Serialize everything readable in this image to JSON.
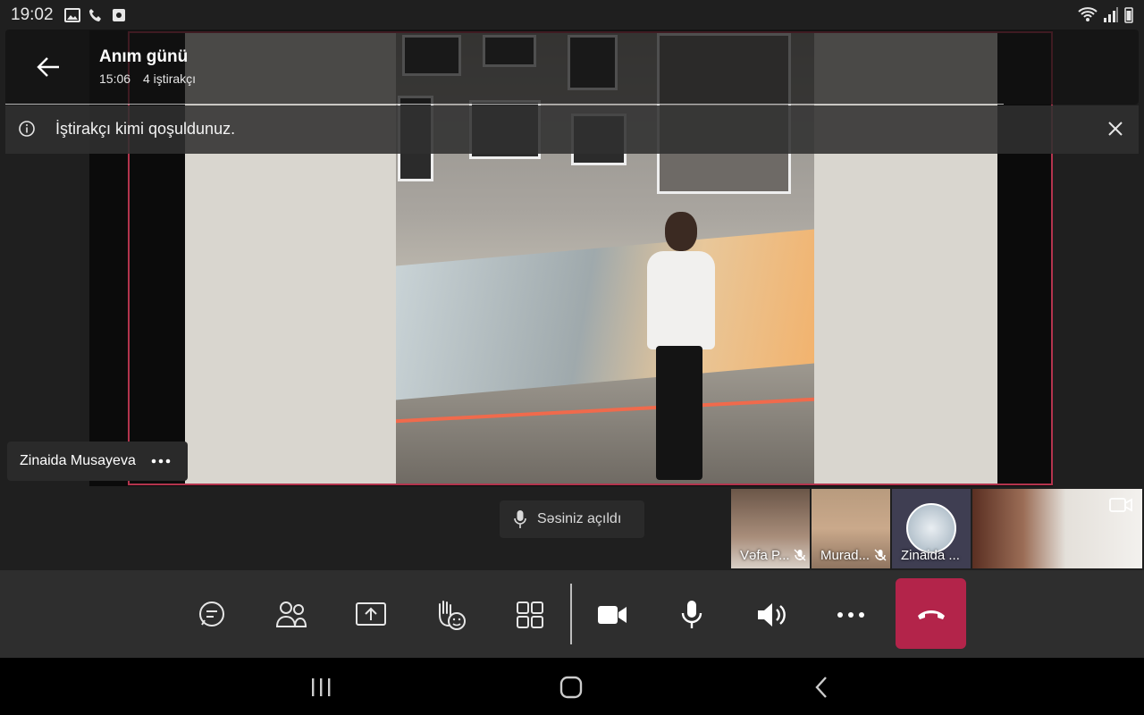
{
  "status_bar": {
    "time": "19:02",
    "left_icons": [
      "gallery-icon",
      "phone-icon",
      "screenshot-icon"
    ],
    "right_icons": [
      "wifi-icon",
      "signal-icon",
      "battery-icon"
    ]
  },
  "meeting": {
    "title": "Anım günü",
    "duration": "15:06",
    "participants": "4 iştirakçı"
  },
  "notification": {
    "text": "İştirakçı kimi qoşuldunuz."
  },
  "spotlight": {
    "name": "Zinaida Musayeva"
  },
  "toast": {
    "text": "Səsiniz açıldı"
  },
  "thumbnails": [
    {
      "label": "Vəfa P...",
      "muted": true
    },
    {
      "label": "Murad...",
      "muted": true
    },
    {
      "label": "Zinaida ...",
      "muted": false
    }
  ],
  "controls": {
    "items": [
      "chat",
      "participants",
      "share",
      "raise-hand",
      "view",
      "camera",
      "microphone",
      "speaker",
      "more",
      "hang-up"
    ]
  },
  "colors": {
    "accent": "#b3244a",
    "frame_border": "#b3344d",
    "bar_bg": "#2e2e2e"
  }
}
